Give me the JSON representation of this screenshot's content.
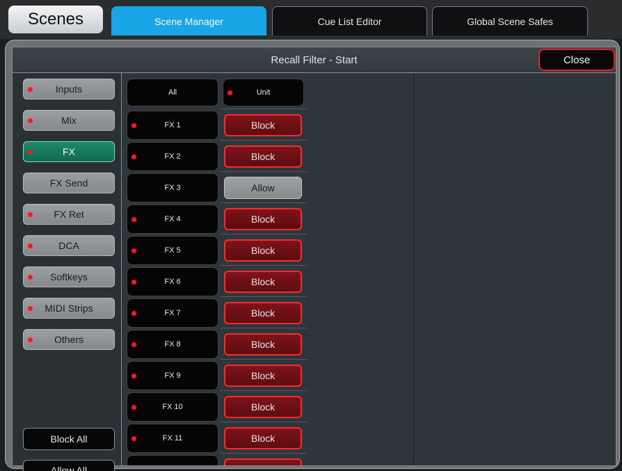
{
  "app": {
    "title": "Scenes"
  },
  "tabs": [
    {
      "label": "Scene Manager",
      "active": true
    },
    {
      "label": "Cue List Editor",
      "active": false
    },
    {
      "label": "Global Scene Safes",
      "active": false
    }
  ],
  "panel": {
    "title": "Recall Filter - Start",
    "close_label": "Close"
  },
  "categories": [
    {
      "label": "Inputs",
      "dot": true,
      "active": false
    },
    {
      "label": "Mix",
      "dot": true,
      "active": false
    },
    {
      "label": "FX",
      "dot": true,
      "active": true
    },
    {
      "label": "FX Send",
      "dot": false,
      "active": false
    },
    {
      "label": "FX Ret",
      "dot": true,
      "active": false
    },
    {
      "label": "DCA",
      "dot": true,
      "active": false
    },
    {
      "label": "Softkeys",
      "dot": true,
      "active": false
    },
    {
      "label": "MIDI Strips",
      "dot": true,
      "active": false
    },
    {
      "label": "Others",
      "dot": true,
      "active": false
    }
  ],
  "actions": {
    "block_all": "Block All",
    "allow_all": "Allow All"
  },
  "header_row": {
    "all_label": "All",
    "unit_label": "Unit"
  },
  "channels": [
    {
      "label": "FX 1",
      "dot": true,
      "state": "Block"
    },
    {
      "label": "FX 2",
      "dot": true,
      "state": "Block"
    },
    {
      "label": "FX 3",
      "dot": false,
      "state": "Allow"
    },
    {
      "label": "FX 4",
      "dot": true,
      "state": "Block"
    },
    {
      "label": "FX 5",
      "dot": true,
      "state": "Block"
    },
    {
      "label": "FX 6",
      "dot": true,
      "state": "Block"
    },
    {
      "label": "FX 7",
      "dot": true,
      "state": "Block"
    },
    {
      "label": "FX 8",
      "dot": true,
      "state": "Block"
    },
    {
      "label": "FX 9",
      "dot": true,
      "state": "Block"
    },
    {
      "label": "FX 10",
      "dot": true,
      "state": "Block"
    },
    {
      "label": "FX 11",
      "dot": true,
      "state": "Block"
    },
    {
      "label": "",
      "dot": false,
      "state": ""
    }
  ],
  "icons": {
    "scroll_grip": "scroll-grip-icon",
    "status_dot": "status-dot-icon"
  },
  "colors": {
    "tab_active": "#18a6e8",
    "block": "#ff2a30",
    "dot": "#ff1818",
    "fx_active": "#1d8a6a"
  }
}
